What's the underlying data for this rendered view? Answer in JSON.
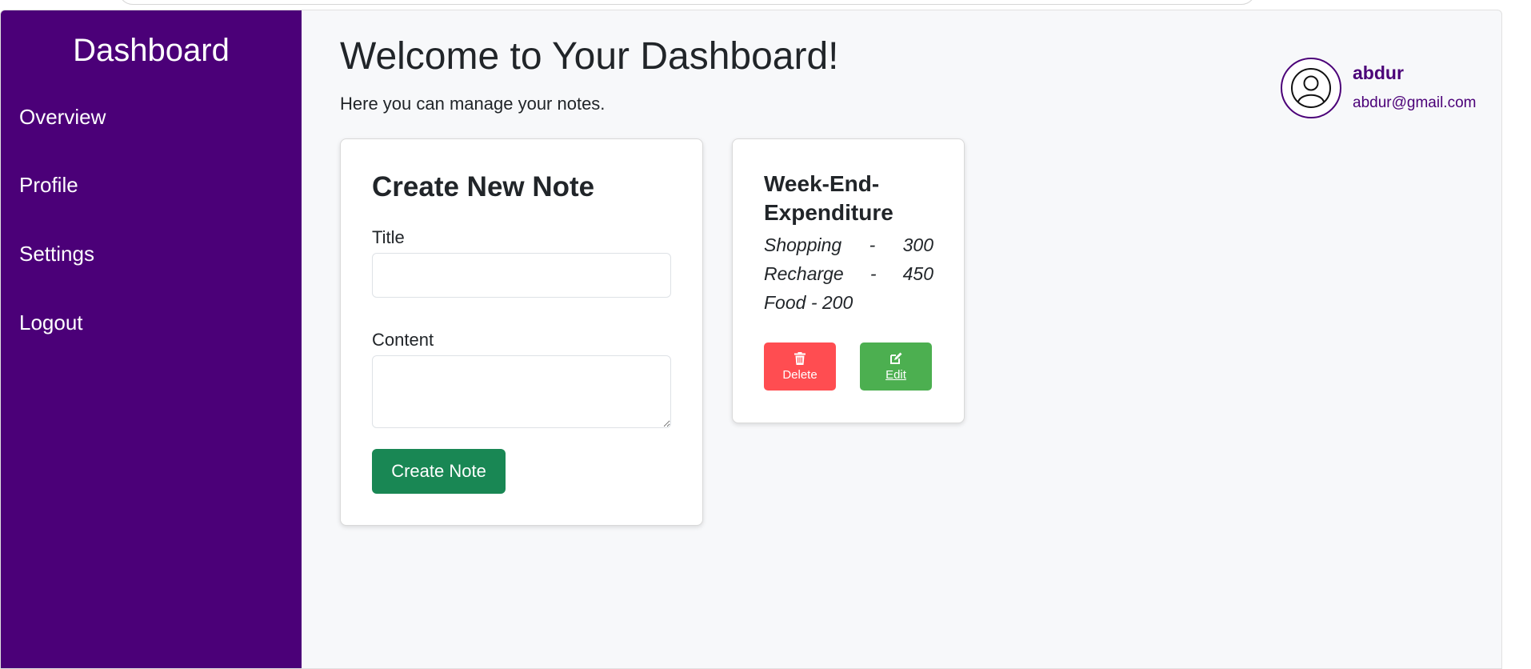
{
  "sidebar": {
    "title": "Dashboard",
    "items": [
      {
        "label": "Overview"
      },
      {
        "label": "Profile"
      },
      {
        "label": "Settings"
      },
      {
        "label": "Logout"
      }
    ]
  },
  "main": {
    "heading": "Welcome to Your Dashboard!",
    "subtitle": "Here you can manage your notes."
  },
  "user": {
    "name": "abdur",
    "email": "abdur@gmail.com",
    "avatar_icon": "user-circle-icon"
  },
  "create_note": {
    "heading": "Create New Note",
    "title_label": "Title",
    "title_value": "",
    "content_label": "Content",
    "content_value": "",
    "submit_label": "Create Note"
  },
  "notes": [
    {
      "title": "Week-End-Expenditure",
      "content": "Shopping - 300 Recharge - 450 Food - 200",
      "delete_label": "Delete",
      "delete_icon": "trash-icon",
      "edit_label": "Edit",
      "edit_icon": "edit-icon"
    }
  ],
  "colors": {
    "sidebar_bg": "#4b0078",
    "create_button": "#198754",
    "delete_button": "#ff4d51",
    "edit_button": "#4caf50",
    "page_bg": "#f7f8fa"
  }
}
